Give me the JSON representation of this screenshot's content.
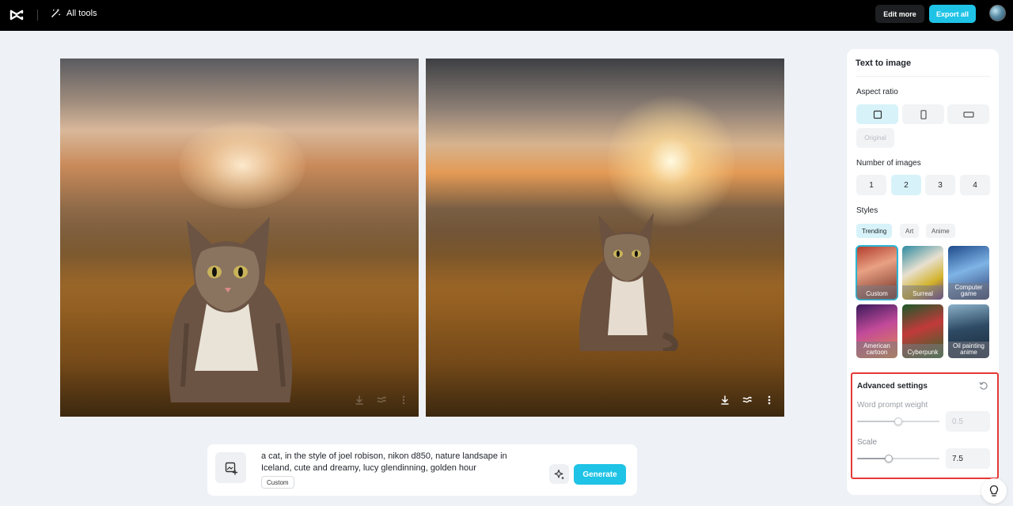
{
  "header": {
    "all_tools_label": "All tools",
    "edit_more_label": "Edit more",
    "export_all_label": "Export all"
  },
  "prompt": {
    "text": "a cat, in the style of joel robison, nikon d850, nature landsape in Iceland, cute and dreamy, lucy glendinning, golden hour",
    "style_tag": "Custom",
    "generate_label": "Generate"
  },
  "panel": {
    "title": "Text to image",
    "aspect_ratio_label": "Aspect ratio",
    "original_label": "Original",
    "aspect_ratio_selected": "square",
    "number_of_images_label": "Number of images",
    "number_options": [
      "1",
      "2",
      "3",
      "4"
    ],
    "number_selected": "2",
    "styles_label": "Styles",
    "style_tabs": [
      "Trending",
      "Art",
      "Anime"
    ],
    "style_tab_selected": "Trending",
    "style_cards": [
      "Custom",
      "Surreal",
      "Computer game",
      "American cartoon",
      "Cyberpunk",
      "Oil painting anime"
    ],
    "style_card_selected": "Custom"
  },
  "advanced": {
    "title": "Advanced settings",
    "word_prompt_weight_label": "Word prompt weight",
    "word_prompt_weight_value": "0.5",
    "word_prompt_weight_level": 0.5,
    "scale_label": "Scale",
    "scale_value": "7.5",
    "scale_level": 0.38
  },
  "colors": {
    "accent": "#1ec3e6",
    "selected_bg": "#d7f3f9",
    "highlight_box": "#e53935"
  }
}
